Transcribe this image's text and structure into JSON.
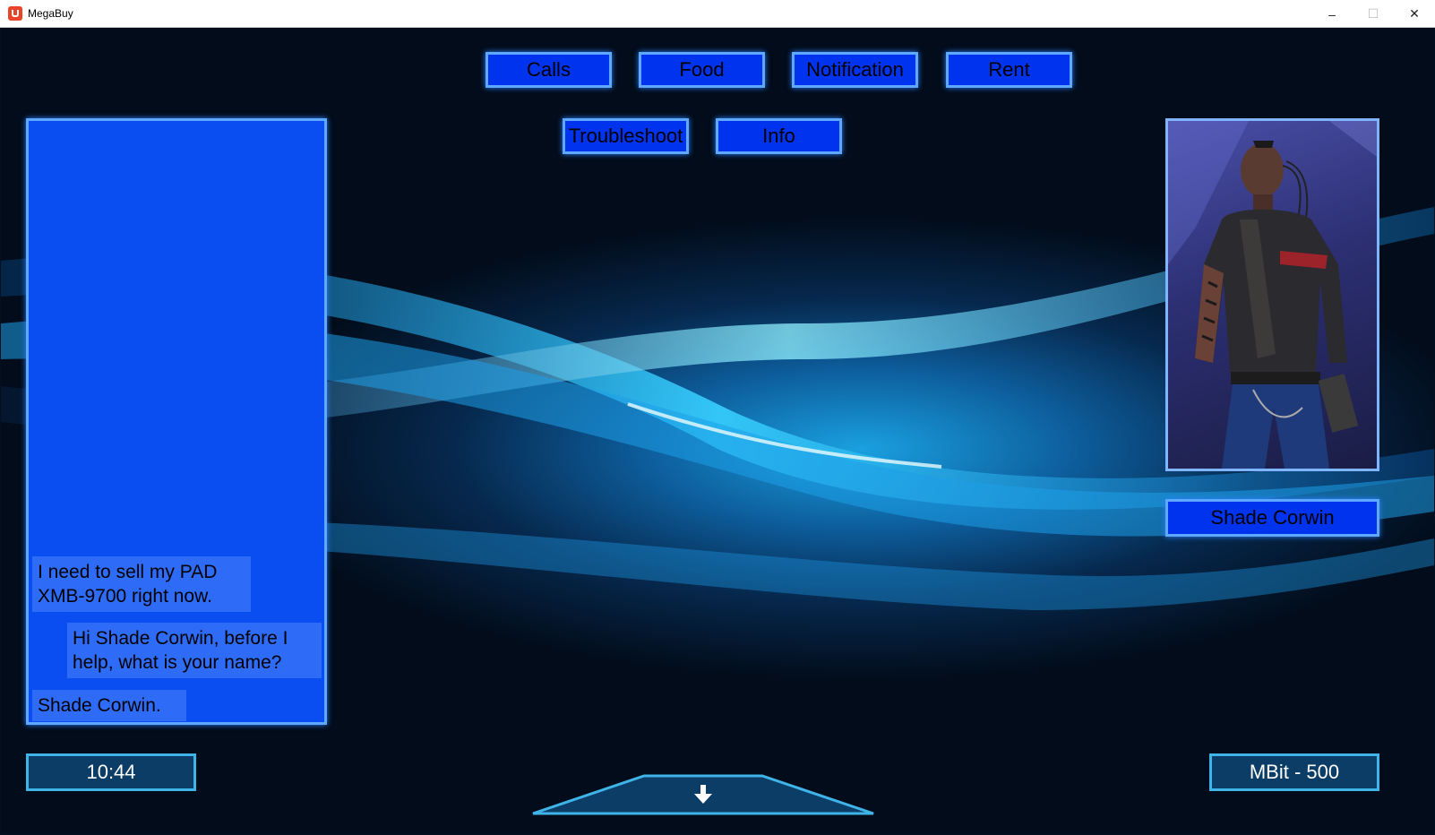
{
  "window": {
    "title": "MegaBuy",
    "minimize": "–",
    "maximize": "☐",
    "close": "✕"
  },
  "nav": {
    "row1": [
      "Calls",
      "Food",
      "Notification",
      "Rent"
    ],
    "row2": [
      "Troubleshoot",
      "Info"
    ]
  },
  "chat": {
    "messages": [
      {
        "text": "I need to sell my PAD XMB-9700 right now.",
        "line1": "I need to sell my PAD",
        "line2": "XMB-9700 right now.",
        "side": "left"
      },
      {
        "text": "Hi Shade Corwin, before I help, what is your name?",
        "line1": "Hi Shade Corwin, before I",
        "line2": "help, what is your name?",
        "side": "right"
      },
      {
        "text": "Shade Corwin.",
        "line1": "Shade Corwin.",
        "side": "left"
      }
    ]
  },
  "contact": {
    "name": "Shade Corwin"
  },
  "clock": "10:44",
  "balance": "MBit - 500",
  "drawer": {
    "icon": "arrow-down-icon"
  },
  "colors": {
    "button_fill": "#0033ee",
    "button_border": "#5ea8ff",
    "panel": "#0a4df0",
    "message": "#2e6cf7",
    "info_fill": "#0b3d66",
    "info_border": "#3fb4e8"
  }
}
